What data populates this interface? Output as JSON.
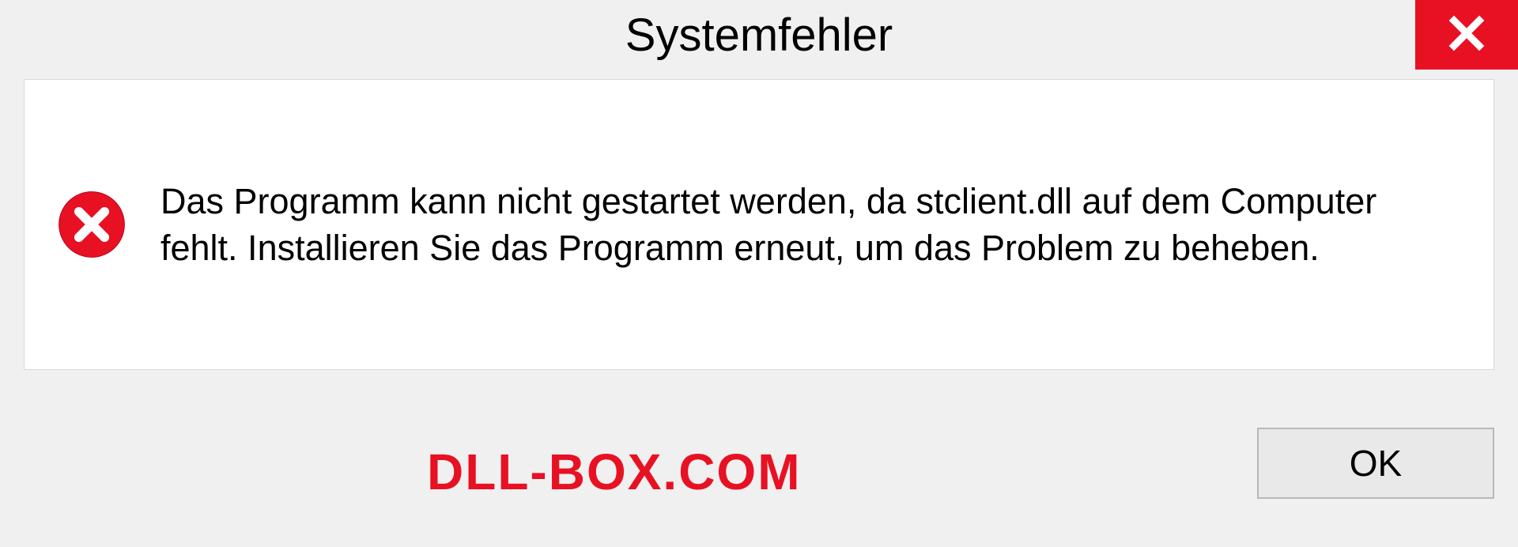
{
  "dialog": {
    "title": "Systemfehler",
    "message": "Das Programm kann nicht gestartet werden, da stclient.dll auf dem Computer fehlt. Installieren Sie das Programm erneut, um das Problem zu beheben.",
    "ok_label": "OK"
  },
  "watermark": "DLL-BOX.COM"
}
